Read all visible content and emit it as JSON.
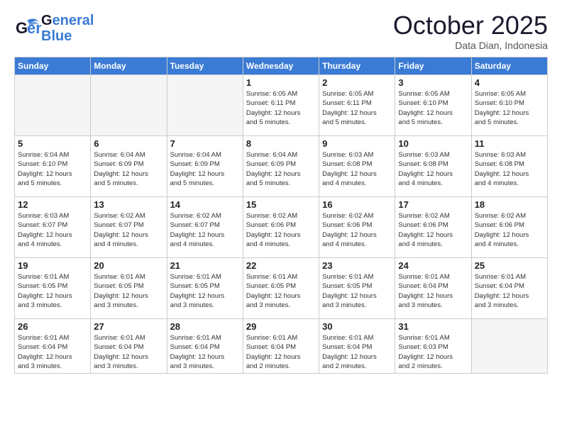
{
  "logo": {
    "line1": "General",
    "line2": "Blue"
  },
  "title": "October 2025",
  "subtitle": "Data Dian, Indonesia",
  "days_header": [
    "Sunday",
    "Monday",
    "Tuesday",
    "Wednesday",
    "Thursday",
    "Friday",
    "Saturday"
  ],
  "weeks": [
    [
      {
        "day": "",
        "info": ""
      },
      {
        "day": "",
        "info": ""
      },
      {
        "day": "",
        "info": ""
      },
      {
        "day": "1",
        "info": "Sunrise: 6:05 AM\nSunset: 6:11 PM\nDaylight: 12 hours\nand 5 minutes."
      },
      {
        "day": "2",
        "info": "Sunrise: 6:05 AM\nSunset: 6:11 PM\nDaylight: 12 hours\nand 5 minutes."
      },
      {
        "day": "3",
        "info": "Sunrise: 6:05 AM\nSunset: 6:10 PM\nDaylight: 12 hours\nand 5 minutes."
      },
      {
        "day": "4",
        "info": "Sunrise: 6:05 AM\nSunset: 6:10 PM\nDaylight: 12 hours\nand 5 minutes."
      }
    ],
    [
      {
        "day": "5",
        "info": "Sunrise: 6:04 AM\nSunset: 6:10 PM\nDaylight: 12 hours\nand 5 minutes."
      },
      {
        "day": "6",
        "info": "Sunrise: 6:04 AM\nSunset: 6:09 PM\nDaylight: 12 hours\nand 5 minutes."
      },
      {
        "day": "7",
        "info": "Sunrise: 6:04 AM\nSunset: 6:09 PM\nDaylight: 12 hours\nand 5 minutes."
      },
      {
        "day": "8",
        "info": "Sunrise: 6:04 AM\nSunset: 6:09 PM\nDaylight: 12 hours\nand 5 minutes."
      },
      {
        "day": "9",
        "info": "Sunrise: 6:03 AM\nSunset: 6:08 PM\nDaylight: 12 hours\nand 4 minutes."
      },
      {
        "day": "10",
        "info": "Sunrise: 6:03 AM\nSunset: 6:08 PM\nDaylight: 12 hours\nand 4 minutes."
      },
      {
        "day": "11",
        "info": "Sunrise: 6:03 AM\nSunset: 6:08 PM\nDaylight: 12 hours\nand 4 minutes."
      }
    ],
    [
      {
        "day": "12",
        "info": "Sunrise: 6:03 AM\nSunset: 6:07 PM\nDaylight: 12 hours\nand 4 minutes."
      },
      {
        "day": "13",
        "info": "Sunrise: 6:02 AM\nSunset: 6:07 PM\nDaylight: 12 hours\nand 4 minutes."
      },
      {
        "day": "14",
        "info": "Sunrise: 6:02 AM\nSunset: 6:07 PM\nDaylight: 12 hours\nand 4 minutes."
      },
      {
        "day": "15",
        "info": "Sunrise: 6:02 AM\nSunset: 6:06 PM\nDaylight: 12 hours\nand 4 minutes."
      },
      {
        "day": "16",
        "info": "Sunrise: 6:02 AM\nSunset: 6:06 PM\nDaylight: 12 hours\nand 4 minutes."
      },
      {
        "day": "17",
        "info": "Sunrise: 6:02 AM\nSunset: 6:06 PM\nDaylight: 12 hours\nand 4 minutes."
      },
      {
        "day": "18",
        "info": "Sunrise: 6:02 AM\nSunset: 6:06 PM\nDaylight: 12 hours\nand 4 minutes."
      }
    ],
    [
      {
        "day": "19",
        "info": "Sunrise: 6:01 AM\nSunset: 6:05 PM\nDaylight: 12 hours\nand 3 minutes."
      },
      {
        "day": "20",
        "info": "Sunrise: 6:01 AM\nSunset: 6:05 PM\nDaylight: 12 hours\nand 3 minutes."
      },
      {
        "day": "21",
        "info": "Sunrise: 6:01 AM\nSunset: 6:05 PM\nDaylight: 12 hours\nand 3 minutes."
      },
      {
        "day": "22",
        "info": "Sunrise: 6:01 AM\nSunset: 6:05 PM\nDaylight: 12 hours\nand 3 minutes."
      },
      {
        "day": "23",
        "info": "Sunrise: 6:01 AM\nSunset: 6:05 PM\nDaylight: 12 hours\nand 3 minutes."
      },
      {
        "day": "24",
        "info": "Sunrise: 6:01 AM\nSunset: 6:04 PM\nDaylight: 12 hours\nand 3 minutes."
      },
      {
        "day": "25",
        "info": "Sunrise: 6:01 AM\nSunset: 6:04 PM\nDaylight: 12 hours\nand 3 minutes."
      }
    ],
    [
      {
        "day": "26",
        "info": "Sunrise: 6:01 AM\nSunset: 6:04 PM\nDaylight: 12 hours\nand 3 minutes."
      },
      {
        "day": "27",
        "info": "Sunrise: 6:01 AM\nSunset: 6:04 PM\nDaylight: 12 hours\nand 3 minutes."
      },
      {
        "day": "28",
        "info": "Sunrise: 6:01 AM\nSunset: 6:04 PM\nDaylight: 12 hours\nand 3 minutes."
      },
      {
        "day": "29",
        "info": "Sunrise: 6:01 AM\nSunset: 6:04 PM\nDaylight: 12 hours\nand 2 minutes."
      },
      {
        "day": "30",
        "info": "Sunrise: 6:01 AM\nSunset: 6:04 PM\nDaylight: 12 hours\nand 2 minutes."
      },
      {
        "day": "31",
        "info": "Sunrise: 6:01 AM\nSunset: 6:03 PM\nDaylight: 12 hours\nand 2 minutes."
      },
      {
        "day": "",
        "info": ""
      }
    ]
  ]
}
